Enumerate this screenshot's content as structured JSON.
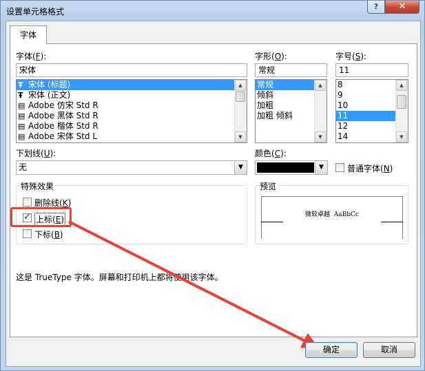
{
  "window": {
    "title": "设置单元格格式",
    "help_label": "?",
    "close_label": "✕"
  },
  "tabs": [
    {
      "label": "字体"
    }
  ],
  "font": {
    "label_main": "字体(",
    "label_key": "F",
    "label_end": "):",
    "value": "宋体",
    "items": [
      {
        "label": "宋体 (标题)",
        "icon": "truetype-icon",
        "selected": true
      },
      {
        "label": "宋体 (正文)",
        "icon": "truetype-icon",
        "selected": false
      },
      {
        "label": "Adobe 仿宋 Std R",
        "icon": "opentype-icon",
        "selected": false
      },
      {
        "label": "Adobe 黑体 Std R",
        "icon": "opentype-icon",
        "selected": false
      },
      {
        "label": "Adobe 楷体 Std R",
        "icon": "opentype-icon",
        "selected": false
      },
      {
        "label": "Adobe 宋体 Std L",
        "icon": "opentype-icon",
        "selected": false
      }
    ]
  },
  "style": {
    "label_main": "字形(",
    "label_key": "O",
    "label_end": "):",
    "value": "常规",
    "items": [
      "常规",
      "倾斜",
      "加粗",
      "加粗 倾斜"
    ],
    "selected_index": 0
  },
  "size": {
    "label_main": "字号(",
    "label_key": "S",
    "label_end": "):",
    "value": "11",
    "items": [
      "8",
      "9",
      "10",
      "11",
      "12",
      "14"
    ],
    "selected_index": 3
  },
  "underline": {
    "label_main": "下划线(",
    "label_key": "U",
    "label_end": "):",
    "value": "无"
  },
  "color": {
    "label_main": "颜色(",
    "label_key": "C",
    "label_end": "):",
    "swatch": "#000000",
    "normal_font_main": "普通字体(",
    "normal_font_key": "N",
    "normal_font_end": ")",
    "normal_font_checked": false
  },
  "effects": {
    "title": "特殊效果",
    "strikethrough": {
      "main": "删除线(",
      "key": "K",
      "end": ")",
      "checked": false
    },
    "superscript": {
      "main": "上标(",
      "key": "E",
      "end": ")",
      "checked": true
    },
    "subscript": {
      "main": "下标(",
      "key": "B",
      "end": ")",
      "checked": false
    }
  },
  "preview": {
    "title": "预览",
    "sample": "微软卓越  AaBbCc"
  },
  "info_text": "这是 TrueType 字体。屏幕和打印机上都将使用该字体。",
  "buttons": {
    "ok": "确定",
    "cancel": "取消"
  },
  "colors": {
    "highlight": "#3399ff",
    "annotation": "#e8413a"
  }
}
